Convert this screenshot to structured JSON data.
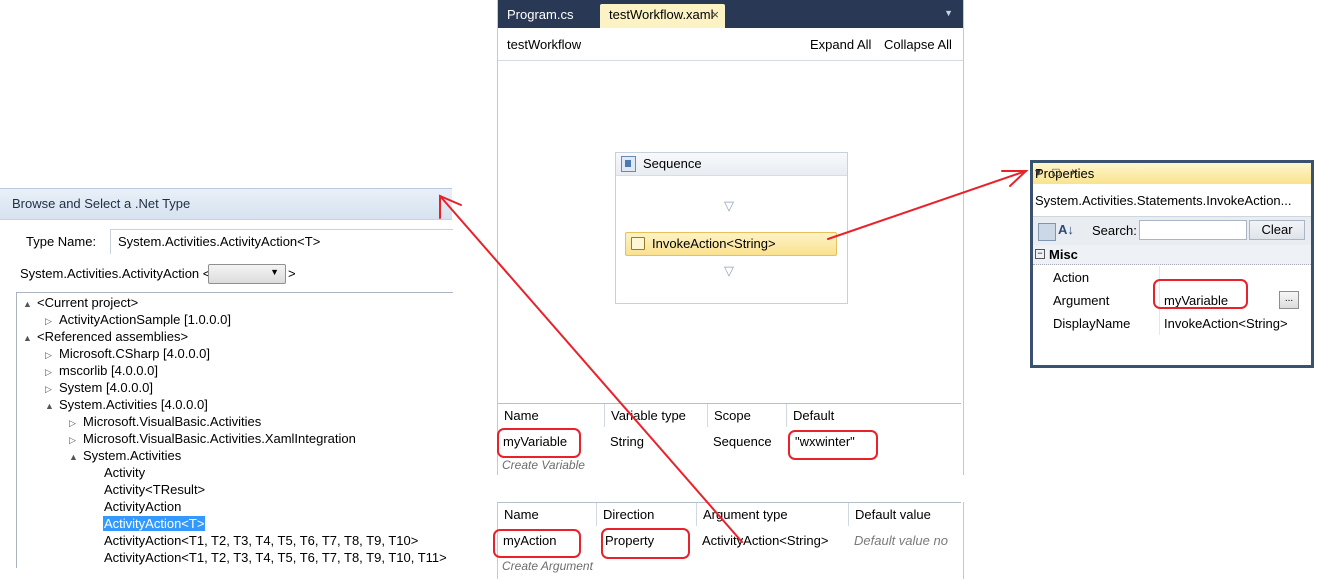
{
  "browse_dialog": {
    "title": "Browse and Select a .Net Type",
    "type_name_label": "Type Name:",
    "type_name_value": "System.Activities.ActivityAction<T>",
    "generic_prefix": "System.Activities.ActivityAction <",
    "generic_suffix": ">",
    "tree": [
      {
        "label": "<Current project>",
        "toggle": "▲"
      },
      {
        "label": "ActivityActionSample [1.0.0.0]",
        "toggle": "▷"
      },
      {
        "label": "<Referenced assemblies>",
        "toggle": "▲"
      },
      {
        "label": "Microsoft.CSharp [4.0.0.0]",
        "toggle": "▷"
      },
      {
        "label": "mscorlib [4.0.0.0]",
        "toggle": "▷"
      },
      {
        "label": "System [4.0.0.0]",
        "toggle": "▷"
      },
      {
        "label": "System.Activities [4.0.0.0]",
        "toggle": "▲"
      },
      {
        "label": "Microsoft.VisualBasic.Activities",
        "toggle": "▷"
      },
      {
        "label": "Microsoft.VisualBasic.Activities.XamlIntegration",
        "toggle": "▷"
      },
      {
        "label": "System.Activities",
        "toggle": "▲"
      },
      {
        "label": "Activity",
        "toggle": ""
      },
      {
        "label": "Activity<TResult>",
        "toggle": ""
      },
      {
        "label": "ActivityAction",
        "toggle": ""
      },
      {
        "label": "ActivityAction<T>",
        "toggle": ""
      },
      {
        "label": "ActivityAction<T1, T2, T3, T4, T5, T6, T7, T8, T9, T10>",
        "toggle": ""
      },
      {
        "label": "ActivityAction<T1, T2, T3, T4, T5, T6, T7, T8, T9, T10, T11>",
        "toggle": ""
      }
    ]
  },
  "designer": {
    "tabs": [
      {
        "label": "Program.cs"
      },
      {
        "label": "testWorkflow.xaml",
        "close": "×"
      }
    ],
    "tab_dropdown": "▼",
    "breadcrumb": "testWorkflow",
    "expand_all": "Expand All",
    "collapse_all": "Collapse All",
    "sequence_title": "Sequence",
    "drop_marker": "▽",
    "activity_label": "InvokeAction<String>",
    "variables": {
      "columns": [
        "Name",
        "Variable type",
        "Scope",
        "Default"
      ],
      "rows": [
        [
          "myVariable",
          "String",
          "Sequence",
          "\"wxwinter\""
        ]
      ],
      "create_label": "Create Variable"
    },
    "arguments": {
      "columns": [
        "Name",
        "Direction",
        "Argument type",
        "Default value"
      ],
      "rows": [
        [
          "myAction",
          "Property",
          "ActivityAction<String>",
          "Default value no"
        ]
      ],
      "create_label": "Create Argument"
    }
  },
  "properties": {
    "title": "Properties",
    "title_buttons": "▾ □ ×",
    "object_name": "System.Activities.Statements.InvokeAction...",
    "sort_icon": "A↓",
    "search_label": "Search:",
    "clear_label": "Clear",
    "category_toggle": "−",
    "category": "Misc",
    "rows": [
      {
        "name": "Action",
        "value": ""
      },
      {
        "name": "Argument",
        "value": "myVariable"
      },
      {
        "name": "DisplayName",
        "value": "InvokeAction<String>"
      }
    ],
    "ellipsis": "..."
  },
  "colors": {
    "annotation": "#e8212b",
    "tab_strip": "#293955",
    "active_tab": "#fcf3c4",
    "selection": "#3399ff"
  }
}
